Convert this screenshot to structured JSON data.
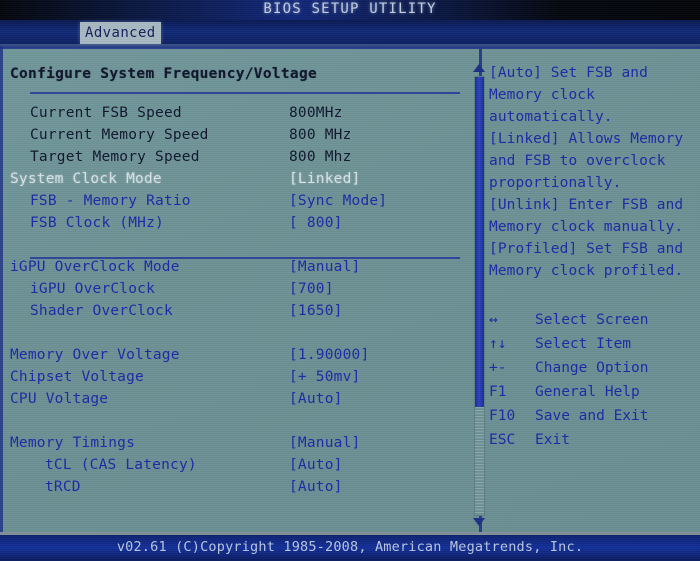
{
  "window": {
    "title": "BIOS SETUP UTILITY",
    "active_tab": "Advanced"
  },
  "colors": {
    "screen_bg": "#6d9295",
    "static_text": "#11182e",
    "option_text": "#1d2aa8",
    "selected_text": "#d8e2e6",
    "accent_border": "#1d2f86",
    "titlebar": "#12277a",
    "footer": "#14309a"
  },
  "main": {
    "section_title": "Configure System Frequency/Voltage",
    "rows": [
      {
        "label": "Current FSB Speed",
        "value": "800MHz",
        "indent": 1,
        "kind": "static"
      },
      {
        "label": "Current Memory Speed",
        "value": "800 MHz",
        "indent": 1,
        "kind": "static"
      },
      {
        "label": "Target Memory Speed",
        "value": "800 Mhz",
        "indent": 1,
        "kind": "static"
      },
      {
        "label": "System Clock Mode",
        "value": "[Linked]",
        "indent": 0,
        "kind": "selected"
      },
      {
        "label": "FSB - Memory Ratio",
        "value": "[Sync Mode]",
        "indent": 1,
        "kind": "option"
      },
      {
        "label": "FSB Clock (MHz)",
        "value": "[ 800]",
        "indent": 1,
        "kind": "option"
      },
      {
        "label": "",
        "value": "",
        "indent": 0,
        "kind": "spacer"
      },
      {
        "label": "iGPU OverClock Mode",
        "value": "[Manual]",
        "indent": 0,
        "kind": "option"
      },
      {
        "label": "iGPU OverClock",
        "value": "[700]",
        "indent": 1,
        "kind": "option"
      },
      {
        "label": "Shader OverClock",
        "value": "[1650]",
        "indent": 1,
        "kind": "option"
      },
      {
        "label": "",
        "value": "",
        "indent": 0,
        "kind": "spacer"
      },
      {
        "label": "Memory Over Voltage",
        "value": "[1.90000]",
        "indent": 0,
        "kind": "option"
      },
      {
        "label": "Chipset Voltage",
        "value": "[+ 50mv]",
        "indent": 0,
        "kind": "option"
      },
      {
        "label": "CPU Voltage",
        "value": "[Auto]",
        "indent": 0,
        "kind": "option"
      },
      {
        "label": "",
        "value": "",
        "indent": 0,
        "kind": "spacer"
      },
      {
        "label": "Memory Timings",
        "value": "[Manual]",
        "indent": 0,
        "kind": "option"
      },
      {
        "label": "tCL (CAS Latency)",
        "value": "[Auto]",
        "indent": 2,
        "kind": "option"
      },
      {
        "label": "tRCD",
        "value": "[Auto]",
        "indent": 2,
        "kind": "option"
      }
    ],
    "scrollbar": {
      "up_arrow": "▲",
      "down_arrow": "▼"
    }
  },
  "help": {
    "lines": [
      "[Auto] Set FSB and",
      "Memory clock",
      "automatically.",
      "[Linked] Allows Memory",
      "and FSB to overclock",
      "proportionally.",
      "[Unlink] Enter FSB and",
      "Memory clock manually.",
      "[Profiled] Set FSB and",
      "Memory clock profiled."
    ]
  },
  "nav": {
    "items": [
      {
        "key": "↔",
        "desc": "Select Screen"
      },
      {
        "key": "↑↓",
        "desc": "Select Item"
      },
      {
        "key": "+-",
        "desc": "Change Option"
      },
      {
        "key": "F1",
        "desc": "General Help"
      },
      {
        "key": "F10",
        "desc": "Save and Exit"
      },
      {
        "key": "ESC",
        "desc": "Exit"
      }
    ]
  },
  "footer": {
    "text": "v02.61 (C)Copyright 1985-2008, American Megatrends, Inc."
  }
}
